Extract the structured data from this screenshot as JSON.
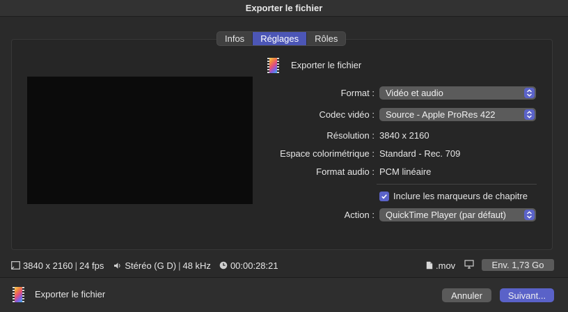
{
  "window": {
    "title": "Exporter le fichier"
  },
  "tabs": [
    {
      "label": "Infos",
      "active": false
    },
    {
      "label": "Réglages",
      "active": true
    },
    {
      "label": "Rôles",
      "active": false
    }
  ],
  "header": {
    "title": "Exporter le fichier",
    "icon": "film-strip-icon"
  },
  "settings": {
    "format": {
      "label": "Format :",
      "value": "Vidéo et audio"
    },
    "codec": {
      "label": "Codec vidéo :",
      "value": "Source - Apple ProRes 422"
    },
    "resolution": {
      "label": "Résolution :",
      "value": "3840 x 2160"
    },
    "colorspace": {
      "label": "Espace colorimétrique :",
      "value": "Standard - Rec. 709"
    },
    "audio_format": {
      "label": "Format audio :",
      "value": "PCM linéaire"
    },
    "chapters": {
      "label": "Inclure les marqueurs de chapitre",
      "checked": true
    },
    "action": {
      "label": "Action :",
      "value": "QuickTime Player (par défaut)"
    }
  },
  "infobar": {
    "resolution": "3840 x 2160",
    "fps": "24 fps",
    "audio": "Stéréo (G D)",
    "sample_rate": "48 kHz",
    "duration": "00:00:28:21",
    "extension": ".mov",
    "size": "Env. 1,73 Go"
  },
  "footer": {
    "title": "Exporter le fichier",
    "cancel_label": "Annuler",
    "next_label": "Suivant..."
  },
  "colors": {
    "accent": "#5a62c8",
    "panel": "#262626",
    "background": "#2a2a2a"
  }
}
